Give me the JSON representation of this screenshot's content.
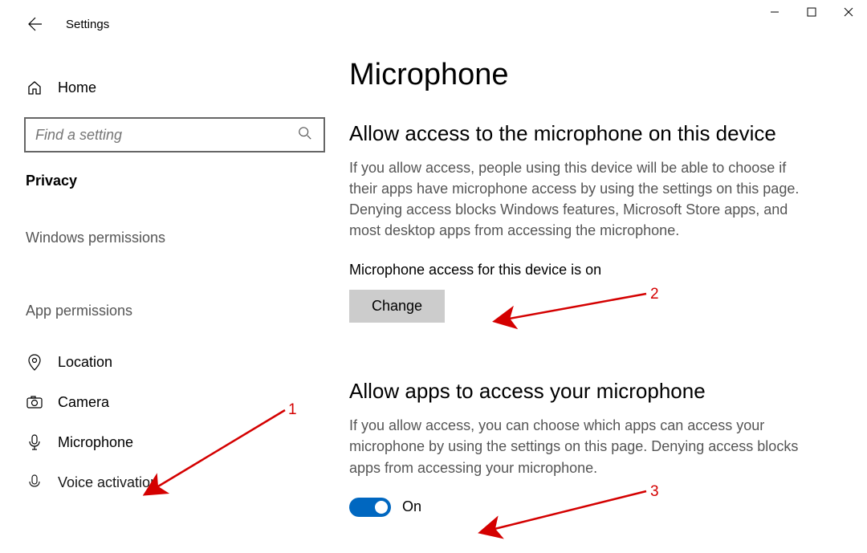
{
  "app": {
    "title": "Settings"
  },
  "sidebar": {
    "home": "Home",
    "search_placeholder": "Find a setting",
    "category": "Privacy",
    "groups": {
      "windows_permissions": "Windows permissions",
      "app_permissions": "App permissions"
    },
    "items": {
      "location": "Location",
      "camera": "Camera",
      "microphone": "Microphone",
      "voice_activation": "Voice activation"
    }
  },
  "main": {
    "title": "Microphone",
    "section1": {
      "heading": "Allow access to the microphone on this device",
      "desc": "If you allow access, people using this device will be able to choose if their apps have microphone access by using the settings on this page. Denying access blocks Windows features, Microsoft Store apps, and most desktop apps from accessing the microphone.",
      "status": "Microphone access for this device is on",
      "change_label": "Change"
    },
    "section2": {
      "heading": "Allow apps to access your microphone",
      "desc": "If you allow access, you can choose which apps can access your microphone by using the settings on this page. Denying access blocks apps from accessing your microphone.",
      "toggle_label": "On"
    }
  },
  "annotations": {
    "a1": "1",
    "a2": "2",
    "a3": "3"
  }
}
